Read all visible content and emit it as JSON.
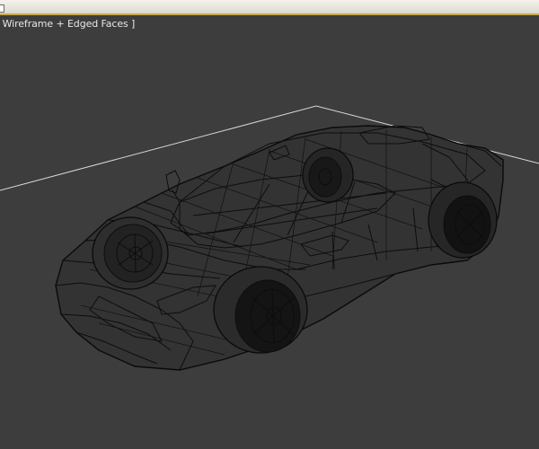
{
  "viewport": {
    "label": "[ Wireframe + Edged Faces ]"
  },
  "colors": {
    "background": "#3d3d3d",
    "grid_line": "#d8d8d8",
    "wire": "#0d0d0d",
    "titlebar_accent": "#c8a64a"
  },
  "icons": {
    "corner": "viewport-menu-icon"
  }
}
